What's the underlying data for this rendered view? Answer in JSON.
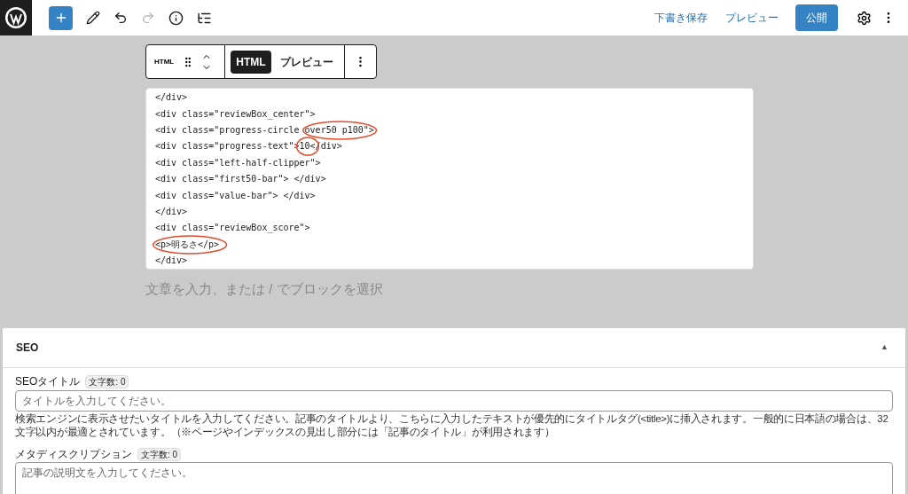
{
  "toolbar": {
    "undo_disabled": false,
    "redo_disabled": true,
    "actions": [
      {
        "label": "下書き保存",
        "kind": "link"
      },
      {
        "label": "プレビュー",
        "kind": "link"
      },
      {
        "label": "公開",
        "kind": "primary"
      }
    ]
  },
  "content": {
    "block_toolbar": {
      "block": "HTML",
      "tabs": [
        {
          "label": "HTML",
          "selected": true
        },
        {
          "label": "プレビュー",
          "selected": false
        }
      ]
    },
    "code_lines": [
      {
        "text": "</div>"
      },
      {
        "text": "<div class=\"reviewBox_center\">"
      },
      {
        "text": "<div class=\"progress-circle over50 p100\">",
        "circled": true
      },
      {
        "text": "<div class=\"progress-text\">10</div>",
        "circled": true
      },
      {
        "text": "<div class=\"left-half-clipper\">"
      },
      {
        "text": "<div class=\"first50-bar\"> </div>"
      },
      {
        "text": "<div class=\"value-bar\"> </div>"
      },
      {
        "text": "</div>"
      },
      {
        "text": "<div class=\"reviewBox_score\">"
      },
      {
        "text": "<p>明るさ</p>",
        "circled": true
      },
      {
        "text": "</div>"
      }
    ],
    "block_placeholder": "文章を入力、または / でブロックを選択"
  },
  "seo_panel": {
    "title": "SEO",
    "toggle": "▲",
    "fields": [
      {
        "label": "SEOタイトル",
        "count": "文字数: 0",
        "kind": "input",
        "placeholder": "タイトルを入力してください。",
        "help": "検索エンジンに表示させたいタイトルを入力してください。記事のタイトルより、こちらに入力したテキストが優先的にタイトルタグ(<title>)に挿入されます。一般的に日本語の場合は、32文字以内が最適とされています。（※ページやインデックスの見出し部分には「記事のタイトル」が利用されます）"
      },
      {
        "label": "メタディスクリプション",
        "count": "文字数: 0",
        "kind": "textarea",
        "placeholder": "記事の説明文を入力してください。"
      }
    ]
  }
}
